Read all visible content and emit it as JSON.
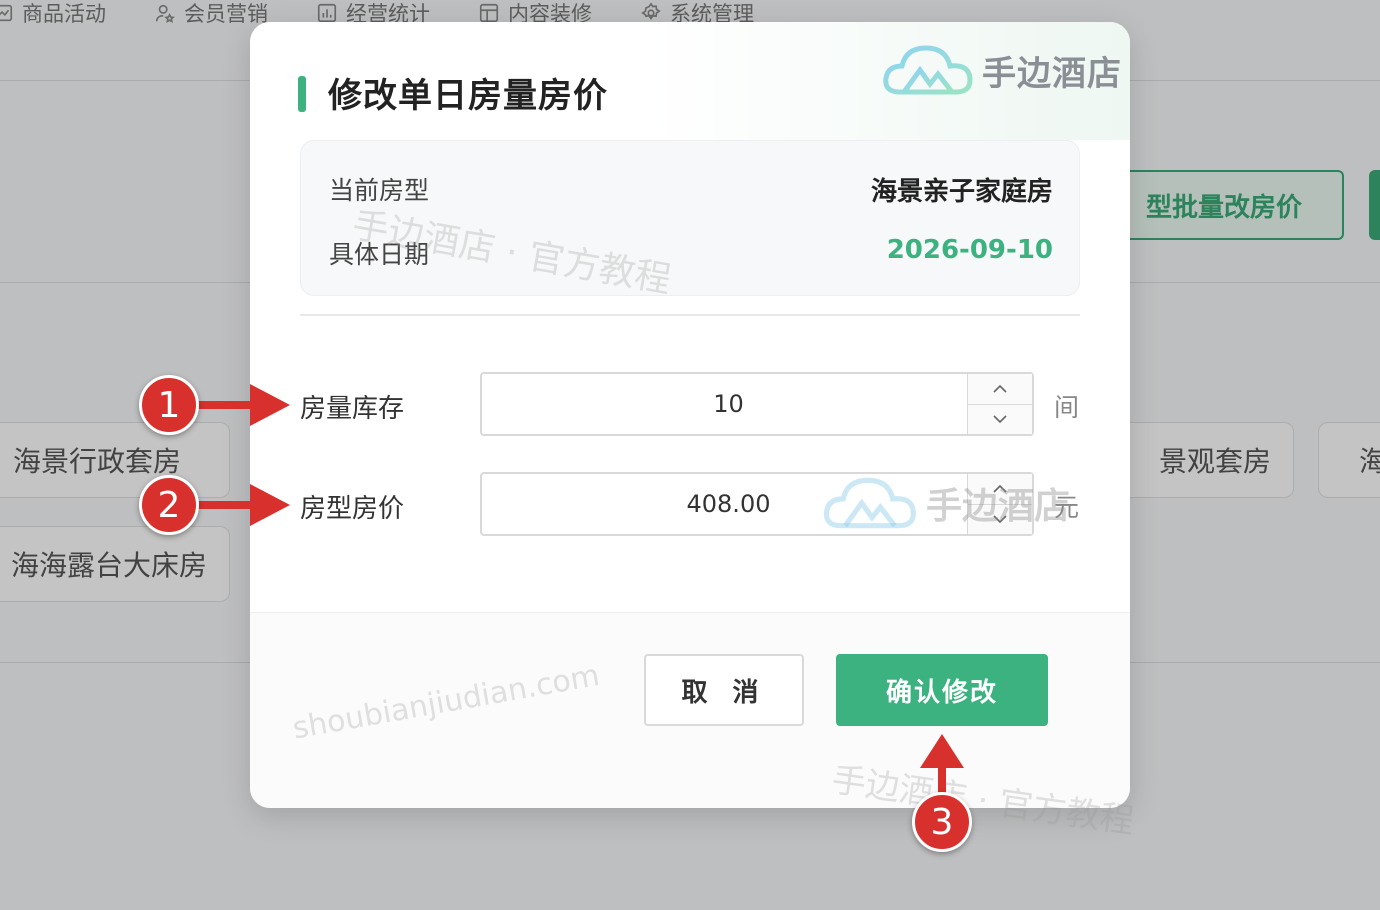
{
  "background": {
    "nav": [
      {
        "label": "商品活动",
        "icon": "chart-icon"
      },
      {
        "label": "会员营销",
        "icon": "user-star-icon"
      },
      {
        "label": "经营统计",
        "icon": "bar-chart-icon"
      },
      {
        "label": "内容装修",
        "icon": "layout-icon"
      },
      {
        "label": "系统管理",
        "icon": "gear-icon"
      }
    ],
    "batch_button": "型批量改房价",
    "rooms": [
      "海景行政套房",
      "海海露台大床房",
      "景观套房",
      "海"
    ]
  },
  "modal": {
    "title": "修改单日房量房价",
    "logo_text": "手边酒店",
    "info": {
      "room_type_label": "当前房型",
      "room_type_value": "海景亲子家庭房",
      "date_label": "具体日期",
      "date_value": "2026-09-10"
    },
    "fields": {
      "inventory_label": "房量库存",
      "inventory_value": "10",
      "inventory_unit": "间",
      "price_label": "房型房价",
      "price_value": "408.00",
      "price_unit": "元"
    },
    "cancel_label": "取 消",
    "confirm_label": "确认修改"
  },
  "watermarks": {
    "tutorial": "手边酒店 · 官方教程",
    "site": "shoubianjiudian.com",
    "logo_text": "手边酒店"
  },
  "annotations": [
    "1",
    "2",
    "3"
  ],
  "colors": {
    "accent": "#3bb27f",
    "annotation_red": "#d8302c"
  }
}
